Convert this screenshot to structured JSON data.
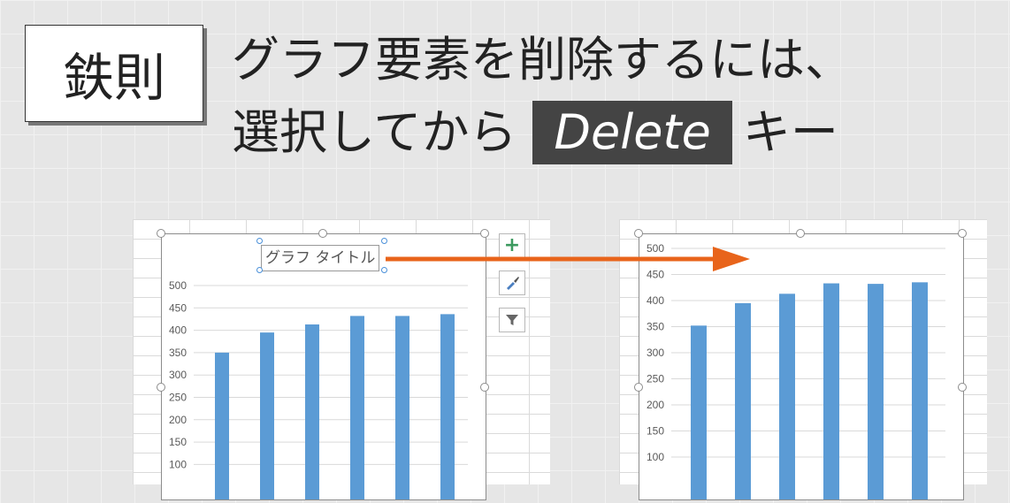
{
  "badge": {
    "label": "鉄則"
  },
  "headline": {
    "line1": "グラフ要素を削除するには、",
    "line2_prefix": "選択してから",
    "key_label": "Delete",
    "line2_suffix": "キー"
  },
  "left_chart": {
    "title_text": "グラフ タイトル",
    "tools": [
      {
        "icon": "plus-icon"
      },
      {
        "icon": "brush-icon"
      },
      {
        "icon": "filter-icon"
      }
    ]
  },
  "arrow": {
    "color": "#e8641b"
  },
  "accent_bar_color": "#5b9bd5",
  "chart_data": [
    {
      "type": "bar",
      "title": "グラフ タイトル",
      "values": [
        350,
        395,
        413,
        432,
        432,
        436
      ],
      "y_ticks": [
        "500",
        "450",
        "400",
        "350",
        "300",
        "250",
        "200",
        "150",
        "100"
      ],
      "ylim": [
        100,
        500
      ],
      "grid": true
    },
    {
      "type": "bar",
      "title": "",
      "values": [
        352,
        395,
        413,
        433,
        432,
        435
      ],
      "y_ticks": [
        "500",
        "450",
        "400",
        "350",
        "300",
        "250",
        "200",
        "150",
        "100"
      ],
      "ylim": [
        100,
        500
      ],
      "grid": true
    }
  ]
}
